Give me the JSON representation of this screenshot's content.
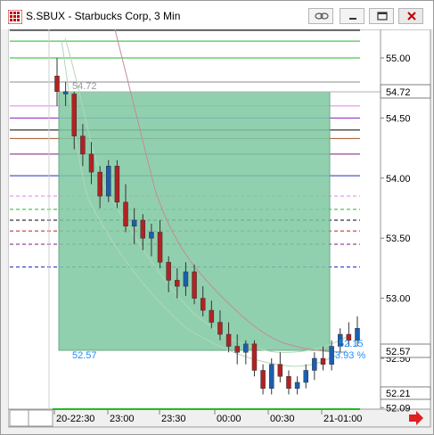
{
  "window": {
    "title": "S.SBUX - Starbucks Corp, 3 Min",
    "buttons": [
      "link-icon",
      "minimize-icon",
      "maximize-icon",
      "close-icon"
    ]
  },
  "price_axis": {
    "ticks": [
      "55.00",
      "54.50",
      "54.00",
      "53.50",
      "53.00",
      "52.50",
      "52.09"
    ],
    "tick_values": [
      55.0,
      54.5,
      54.0,
      53.5,
      53.0,
      52.5,
      52.09
    ],
    "last_price_label": "52.57",
    "high_marker_label": "54.72",
    "bottom_marker_label": "52.21"
  },
  "time_axis": {
    "ticks": [
      "20-22:30",
      "23:00",
      "23:30",
      "00:00",
      "00:30",
      "21-01:00"
    ]
  },
  "drawing": {
    "top_label": "54.72",
    "bottom_label": "52.57",
    "right_label": "52.15",
    "percent_label": "3.93 %"
  },
  "chart_data": {
    "type": "candlestick",
    "title": "",
    "ylim": [
      52.09,
      55.2
    ],
    "x": [
      "20-22:30",
      "23:00",
      "23:30",
      "00:00",
      "00:30",
      "21-01:00"
    ],
    "candles": [
      [
        54.85,
        55.0,
        54.6,
        54.72,
        "down"
      ],
      [
        54.72,
        54.8,
        54.6,
        54.7,
        "up"
      ],
      [
        54.7,
        54.72,
        54.24,
        54.35,
        "down"
      ],
      [
        54.35,
        54.45,
        54.1,
        54.2,
        "down"
      ],
      [
        54.2,
        54.3,
        53.95,
        54.05,
        "down"
      ],
      [
        54.05,
        54.1,
        53.75,
        53.85,
        "down"
      ],
      [
        53.85,
        54.15,
        53.8,
        54.1,
        "up"
      ],
      [
        54.1,
        54.15,
        53.75,
        53.8,
        "down"
      ],
      [
        53.8,
        53.95,
        53.55,
        53.6,
        "down"
      ],
      [
        53.6,
        53.75,
        53.45,
        53.65,
        "up"
      ],
      [
        53.65,
        53.7,
        53.4,
        53.5,
        "down"
      ],
      [
        53.5,
        53.62,
        53.35,
        53.55,
        "up"
      ],
      [
        53.55,
        53.65,
        53.25,
        53.3,
        "down"
      ],
      [
        53.3,
        53.35,
        53.05,
        53.15,
        "down"
      ],
      [
        53.15,
        53.25,
        53.0,
        53.1,
        "down"
      ],
      [
        53.1,
        53.3,
        53.02,
        53.22,
        "up"
      ],
      [
        53.22,
        53.28,
        52.95,
        53.0,
        "down"
      ],
      [
        53.0,
        53.1,
        52.85,
        52.9,
        "down"
      ],
      [
        52.9,
        52.98,
        52.75,
        52.8,
        "down"
      ],
      [
        52.8,
        52.9,
        52.65,
        52.7,
        "down"
      ],
      [
        52.7,
        52.8,
        52.55,
        52.6,
        "down"
      ],
      [
        52.6,
        52.7,
        52.45,
        52.55,
        "down"
      ],
      [
        52.55,
        52.65,
        52.45,
        52.62,
        "up"
      ],
      [
        52.62,
        52.65,
        52.35,
        52.4,
        "down"
      ],
      [
        52.4,
        52.45,
        52.2,
        52.25,
        "down"
      ],
      [
        52.25,
        52.5,
        52.2,
        52.45,
        "up"
      ],
      [
        52.45,
        52.55,
        52.3,
        52.35,
        "down"
      ],
      [
        52.35,
        52.4,
        52.2,
        52.25,
        "down"
      ],
      [
        52.25,
        52.35,
        52.2,
        52.3,
        "up"
      ],
      [
        52.3,
        52.45,
        52.25,
        52.4,
        "up"
      ],
      [
        52.4,
        52.55,
        52.32,
        52.5,
        "up"
      ],
      [
        52.5,
        52.6,
        52.4,
        52.45,
        "down"
      ],
      [
        52.45,
        52.65,
        52.4,
        52.6,
        "up"
      ],
      [
        52.6,
        52.75,
        52.55,
        52.7,
        "up"
      ],
      [
        52.7,
        52.8,
        52.6,
        52.65,
        "down"
      ],
      [
        52.65,
        52.85,
        52.6,
        52.75,
        "up"
      ]
    ],
    "level_lines": [
      {
        "price": 55.23,
        "color": "#000000",
        "dash": false
      },
      {
        "price": 55.14,
        "color": "#22b822",
        "dash": false
      },
      {
        "price": 55.0,
        "color": "#22b822",
        "dash": false
      },
      {
        "price": 54.8,
        "color": "#8c8c8c",
        "dash": false
      },
      {
        "price": 54.6,
        "color": "#e080e0",
        "dash": false
      },
      {
        "price": 54.5,
        "color": "#8a1ac4",
        "dash": false
      },
      {
        "price": 54.4,
        "color": "#000000",
        "dash": false
      },
      {
        "price": 54.33,
        "color": "#a0522d",
        "dash": false
      },
      {
        "price": 54.2,
        "color": "#7a1a7a",
        "dash": false
      },
      {
        "price": 54.02,
        "color": "#1a2ec0",
        "dash": false
      },
      {
        "price": 53.85,
        "color": "#e080e0",
        "dash": true
      },
      {
        "price": 53.74,
        "color": "#22b822",
        "dash": true
      },
      {
        "price": 53.65,
        "color": "#000000",
        "dash": true
      },
      {
        "price": 53.56,
        "color": "#b22222",
        "dash": true
      },
      {
        "price": 53.45,
        "color": "#7a1a7a",
        "dash": true
      },
      {
        "price": 53.26,
        "color": "#1a2ec0",
        "dash": true
      }
    ],
    "colors": {
      "up": "#1a5fb0",
      "down": "#b22222",
      "box_fill": "#7ec8a0",
      "background": "#ffffff",
      "accent_blue": "#1e90ff",
      "arrow_red": "#e02020"
    }
  }
}
